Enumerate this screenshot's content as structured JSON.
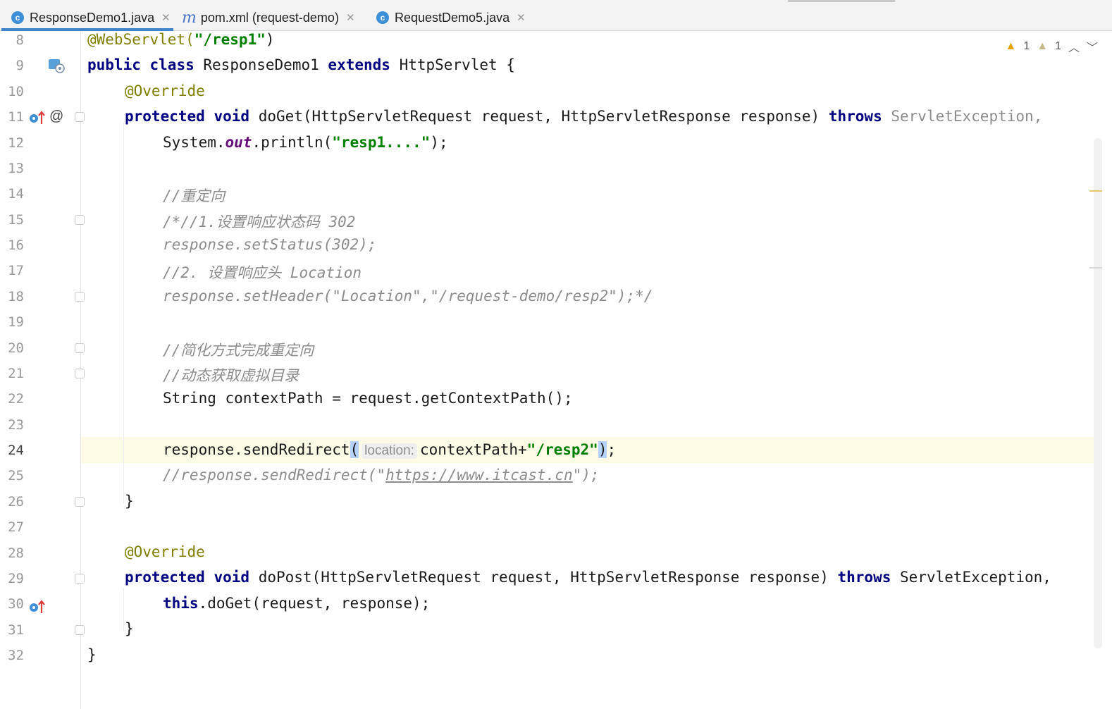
{
  "tabs": [
    {
      "label": "ResponseDemo1.java",
      "icon": "class-c-icon",
      "active": true
    },
    {
      "label": "pom.xml (request-demo)",
      "icon": "maven-m-icon",
      "active": false
    },
    {
      "label": "RequestDemo5.java",
      "icon": "class-c-icon",
      "active": false
    }
  ],
  "inspection": {
    "warnings": "1",
    "weak_warnings": "1"
  },
  "line_numbers": [
    "8",
    "9",
    "10",
    "11",
    "12",
    "13",
    "14",
    "15",
    "16",
    "17",
    "18",
    "19",
    "20",
    "21",
    "22",
    "23",
    "24",
    "25",
    "26",
    "27",
    "28",
    "29",
    "30",
    "31",
    "32"
  ],
  "code": {
    "l8": {
      "ann": "@WebServlet(",
      "str": "\"/resp1\"",
      "close": ")"
    },
    "l9": {
      "kw1": "public",
      "kw2": "class",
      "name": "ResponseDemo1",
      "kw3": "extends",
      "rest": "HttpServlet {"
    },
    "l10": {
      "ann": "@Override"
    },
    "l11": {
      "kw1": "protected",
      "kw2": "void",
      "sig": "doGet(HttpServletRequest request, HttpServletResponse response)",
      "kw3": "throws",
      "exc": "ServletException,"
    },
    "l12": {
      "pre": "System.",
      "fld": "out",
      "mid": ".println(",
      "str": "\"resp1....\"",
      "post": ");"
    },
    "l14": "//重定向",
    "l15": "/*//1.设置响应状态码 302",
    "l16": "response.setStatus(302);",
    "l17": "//2. 设置响应头 Location",
    "l18": "response.setHeader(\"Location\",\"/request-demo/resp2\");*/",
    "l20": "//简化方式完成重定向",
    "l21": "//动态获取虚拟目录",
    "l22": "String contextPath = request.getContextPath();",
    "l24": {
      "pre": "response.sendRedirect",
      "open": "(",
      "hint": "location:",
      "arg": "contextPath+",
      "str": "\"/resp2\"",
      "close": ")",
      "end": ";"
    },
    "l25": {
      "pre": "//response.sendRedirect(\"",
      "url": "https://www.itcast.cn",
      "post": "\");"
    },
    "l26": "}",
    "l28": {
      "ann": "@Override"
    },
    "l29": {
      "kw1": "protected",
      "kw2": "void",
      "sig": "doPost(HttpServletRequest request, HttpServletResponse response)",
      "kw3": "throws",
      "exc": "ServletException,"
    },
    "l30": {
      "kw": "this",
      "rest": ".doGet(request, response);"
    },
    "l31": "}",
    "l32": "}"
  },
  "colors": {
    "keyword": "#000080",
    "annotation": "#808000",
    "string": "#008000",
    "comment": "#8c8c8c",
    "accent": "#4083c9"
  }
}
